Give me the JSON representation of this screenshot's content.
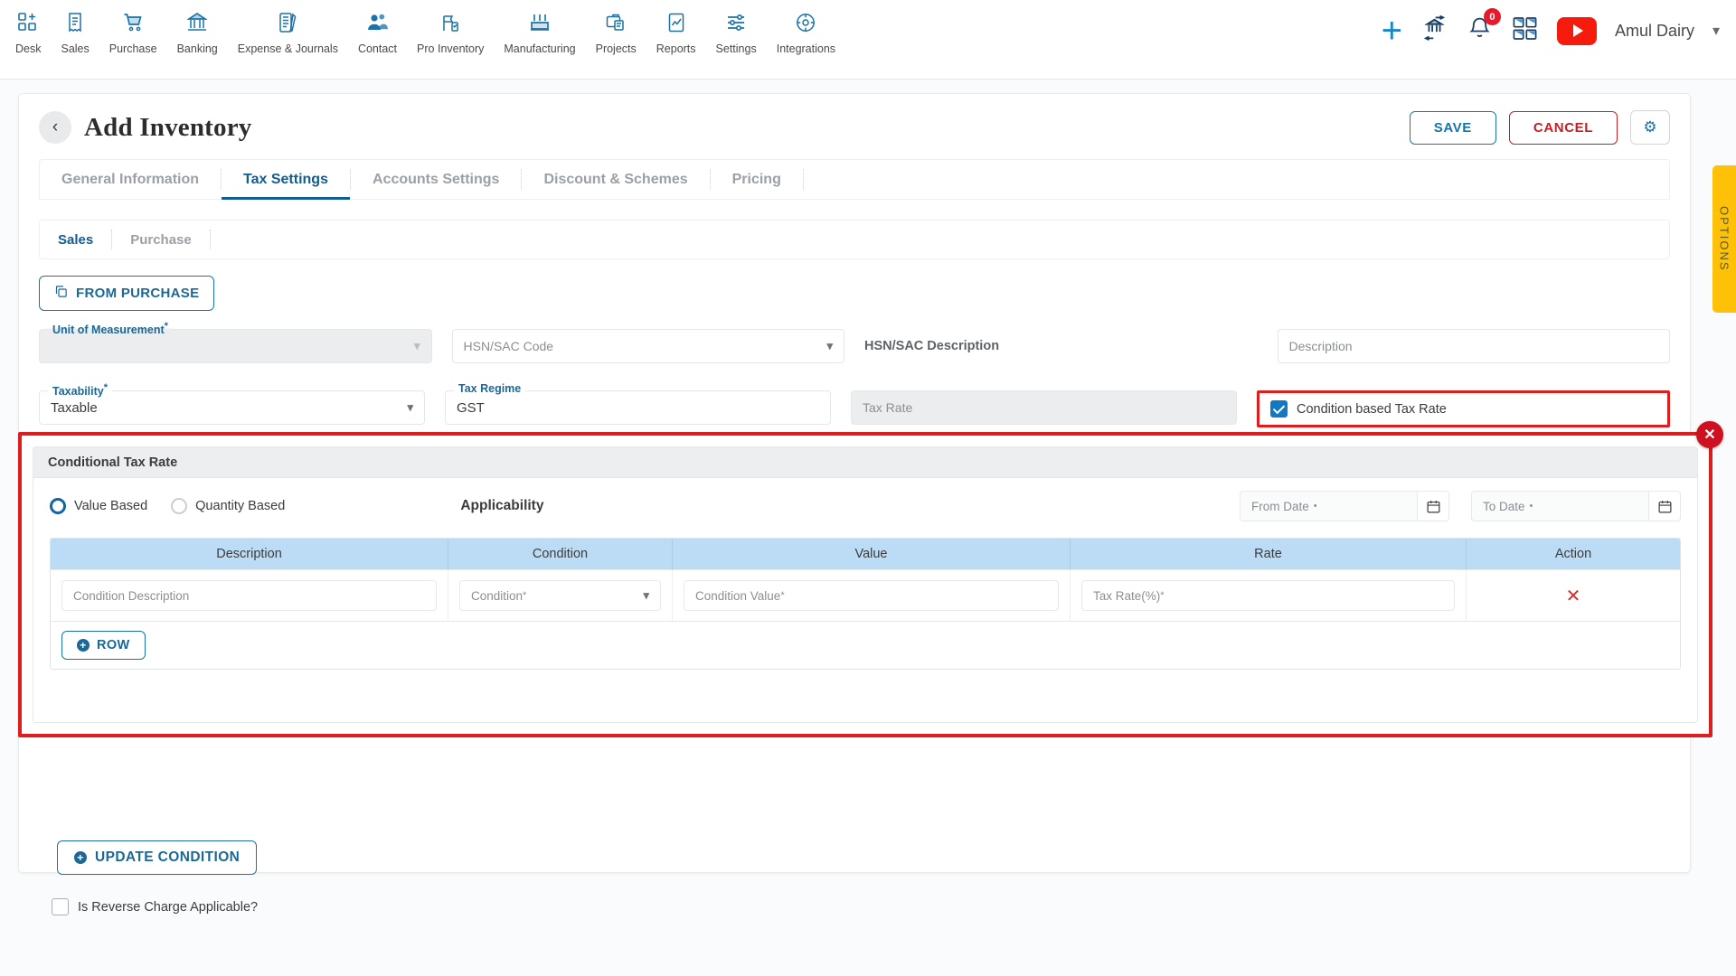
{
  "topnav": {
    "items": [
      {
        "label": "Desk",
        "icon": "desk-icon"
      },
      {
        "label": "Sales",
        "icon": "receipt-icon"
      },
      {
        "label": "Purchase",
        "icon": "cart-icon"
      },
      {
        "label": "Banking",
        "icon": "bank-icon"
      },
      {
        "label": "Expense & Journals",
        "icon": "journal-icon"
      },
      {
        "label": "Contact",
        "icon": "contacts-icon"
      },
      {
        "label": "Pro Inventory",
        "icon": "inventory-icon"
      },
      {
        "label": "Manufacturing",
        "icon": "factory-icon"
      },
      {
        "label": "Projects",
        "icon": "briefcase-icon"
      },
      {
        "label": "Reports",
        "icon": "report-chart-icon"
      },
      {
        "label": "Settings",
        "icon": "sliders-icon"
      },
      {
        "label": "Integrations",
        "icon": "integrations-icon"
      }
    ],
    "add_icon": "plus-icon",
    "bank_icon": "bank-transfer-icon",
    "notification_icon": "bell-icon",
    "notification_count": "0",
    "apps_icon": "apps-grid-icon",
    "video_icon": "youtube-play-icon",
    "org_name": "Amul Dairy",
    "org_caret": "chevron-down-icon"
  },
  "header": {
    "back_icon": "chevron-left-icon",
    "title": "Add Inventory",
    "save_label": "SAVE",
    "cancel_label": "CANCEL",
    "gear_icon": "gear-icon"
  },
  "tabs": [
    {
      "label": "General Information",
      "active": false
    },
    {
      "label": "Tax Settings",
      "active": true
    },
    {
      "label": "Accounts Settings",
      "active": false
    },
    {
      "label": "Discount & Schemes",
      "active": false
    },
    {
      "label": "Pricing",
      "active": false
    }
  ],
  "subtabs": [
    {
      "label": "Sales",
      "active": true
    },
    {
      "label": "Purchase",
      "active": false
    }
  ],
  "form": {
    "from_purchase_label": "FROM PURCHASE",
    "from_purchase_icon": "copy-icon",
    "unit_of_measurement": {
      "label": "Unit of Measurement",
      "required": "*",
      "value": "",
      "disabled": true,
      "chevron": "chevron-down-icon"
    },
    "hsn_sac_code": {
      "placeholder": "HSN/SAC Code",
      "value": "",
      "chevron": "chevron-down-icon"
    },
    "hsn_sac_description": {
      "label": "HSN/SAC Description",
      "placeholder": "Description",
      "value": ""
    },
    "taxability": {
      "label": "Taxability",
      "required": "*",
      "value": "Taxable",
      "chevron": "chevron-down-icon"
    },
    "tax_regime": {
      "label": "Tax Regime",
      "value": "GST"
    },
    "tax_rate": {
      "placeholder": "Tax Rate",
      "value": "",
      "disabled": true
    },
    "condition_based_tax_rate": {
      "label": "Condition based Tax Rate",
      "checked": true
    },
    "reverse_charge": {
      "label": "Is Reverse Charge Applicable?",
      "checked": false
    },
    "update_condition_label": "UPDATE CONDITION",
    "update_condition_icon": "plus-circle-icon"
  },
  "conditional_panel": {
    "title": "Conditional Tax Rate",
    "close_icon": "close-icon",
    "basis_options": [
      {
        "label": "Value Based",
        "selected": true
      },
      {
        "label": "Quantity Based",
        "selected": false
      }
    ],
    "applicability_label": "Applicability",
    "from_date": {
      "placeholder": "From Date",
      "required": "•",
      "value": "",
      "icon": "calendar-icon"
    },
    "to_date": {
      "placeholder": "To Date",
      "required": "•",
      "value": "",
      "icon": "calendar-icon"
    },
    "table": {
      "columns": [
        "Description",
        "Condition",
        "Value",
        "Rate",
        "Action"
      ],
      "rows": [
        {
          "description_placeholder": "Condition Description",
          "condition_placeholder": "Condition",
          "condition_required": "*",
          "condition_chevron": "chevron-down-icon",
          "value_placeholder": "Condition Value",
          "value_required": "*",
          "rate_placeholder": "Tax Rate(%)",
          "rate_required": "*",
          "delete_icon": "close-x-icon"
        }
      ]
    },
    "add_row_label": "ROW",
    "add_row_icon": "plus-circle-icon"
  },
  "options_tab": {
    "label": "OPTIONS"
  },
  "colors": {
    "brand_blue": "#115c90",
    "accent_blue": "#1b72a8",
    "danger_red": "#c32026",
    "highlight_red": "#dd1e1e",
    "table_header_blue": "#bcdcf5",
    "options_yellow": "#ffc107",
    "youtube_red": "#f61c0d",
    "badge_red": "#e8192c"
  }
}
